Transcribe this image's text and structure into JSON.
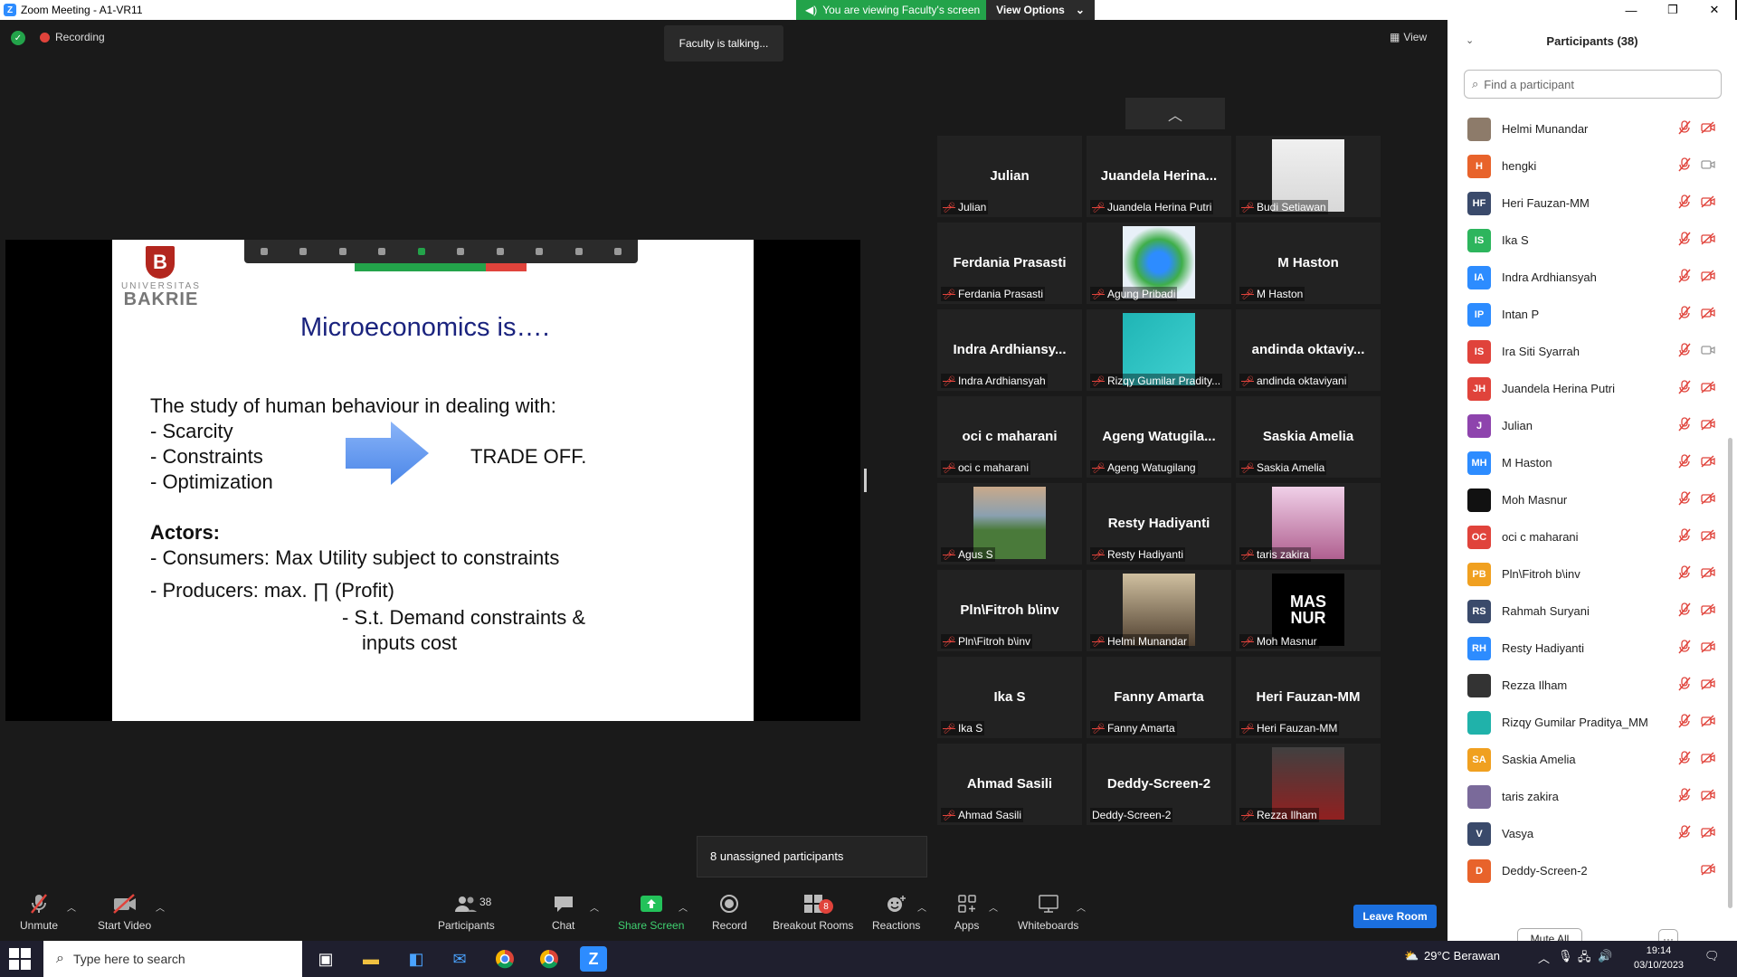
{
  "window": {
    "title": "Zoom Meeting - A1-VR11",
    "viewing_banner": "You are viewing Faculty's screen",
    "view_options": "View Options"
  },
  "topbar": {
    "recording": "Recording",
    "talking": "Faculty is talking...",
    "view": "View"
  },
  "slide": {
    "logo_top": "UNIVERSITAS",
    "logo_bottom": "BAKRIE",
    "title": "Microeconomics is….",
    "intro": "The study of human behaviour in dealing with:",
    "bullets": [
      "-   Scarcity",
      "-   Constraints",
      "-   Optimization"
    ],
    "tradeoff": "TRADE OFF.",
    "actors": "Actors:",
    "consumers": "- Consumers: Max Utility subject to constraints",
    "producers": "-   Producers: max. ∏ (Profit)",
    "demand1": "-  S.t. Demand constraints &",
    "demand2": "inputs cost"
  },
  "gallery": {
    "tiles": [
      {
        "center": "Julian",
        "label": "Julian"
      },
      {
        "center": "Juandela  Herina...",
        "label": "Juandela Herina Putri"
      },
      {
        "center": "",
        "label": "Budi Setiawan"
      },
      {
        "center": "Ferdania Prasasti",
        "label": "Ferdania Prasasti"
      },
      {
        "center": "",
        "label": "Agung Pribadi"
      },
      {
        "center": "M Haston",
        "label": "M Haston"
      },
      {
        "center": "Indra  Ardhiansy...",
        "label": "Indra Ardhiansyah"
      },
      {
        "center": "",
        "label": "Rizqy Gumilar Pradity..."
      },
      {
        "center": "andinda  oktaviy...",
        "label": "andinda oktaviyani"
      },
      {
        "center": "oci c maharani",
        "label": "oci c maharani"
      },
      {
        "center": "Ageng  Watugila...",
        "label": "Ageng Watugilang"
      },
      {
        "center": "Saskia Amelia",
        "label": "Saskia Amelia"
      },
      {
        "center": "",
        "label": "Agus S"
      },
      {
        "center": "Resty Hadiyanti",
        "label": "Resty Hadiyanti"
      },
      {
        "center": "",
        "label": "taris zakira"
      },
      {
        "center": "Pln\\Fitroh b\\inv",
        "label": "Pln\\Fitroh b\\inv"
      },
      {
        "center": "",
        "label": "Helmi Munandar"
      },
      {
        "center": "",
        "label": "Moh Masnur"
      },
      {
        "center": "Ika S",
        "label": "Ika S"
      },
      {
        "center": "Fanny Amarta",
        "label": "Fanny Amarta"
      },
      {
        "center": "Heri Fauzan-MM",
        "label": "Heri Fauzan-MM"
      },
      {
        "center": "Ahmad Sasili",
        "label": "Ahmad Sasili"
      },
      {
        "center": "Deddy-Screen-2",
        "label": "Deddy-Screen-2"
      },
      {
        "center": "",
        "label": "Rezza Ilham"
      }
    ],
    "masnur_logo": "MAS NUR"
  },
  "unassigned": "8 unassigned participants",
  "toolbar": {
    "unmute": "Unmute",
    "start_video": "Start Video",
    "participants": "Participants",
    "participants_count": "38",
    "chat": "Chat",
    "share_screen": "Share Screen",
    "record": "Record",
    "breakout": "Breakout Rooms",
    "breakout_count": "8",
    "reactions": "Reactions",
    "apps": "Apps",
    "whiteboards": "Whiteboards",
    "leave_room": "Leave Room"
  },
  "panel": {
    "title": "Participants (38)",
    "search_placeholder": "Find a participant",
    "mute_all": "Mute All",
    "more": "···",
    "participants": [
      {
        "initials": "",
        "name": "Helmi Munandar",
        "color": "#8d7b6a",
        "video": "off"
      },
      {
        "initials": "H",
        "name": "hengki",
        "color": "#e8632b",
        "video": "on"
      },
      {
        "initials": "HF",
        "name": "Heri Fauzan-MM",
        "color": "#3a4a6b",
        "video": "off"
      },
      {
        "initials": "IS",
        "name": "Ika S",
        "color": "#2db55d",
        "video": "off"
      },
      {
        "initials": "IA",
        "name": "Indra Ardhiansyah",
        "color": "#2d8cff",
        "video": "off"
      },
      {
        "initials": "IP",
        "name": "Intan P",
        "color": "#2d8cff",
        "video": "off"
      },
      {
        "initials": "IS",
        "name": "Ira Siti Syarrah",
        "color": "#e0433b",
        "video": "on"
      },
      {
        "initials": "JH",
        "name": "Juandela Herina Putri",
        "color": "#e0433b",
        "video": "off"
      },
      {
        "initials": "J",
        "name": "Julian",
        "color": "#8e44ad",
        "video": "off"
      },
      {
        "initials": "MH",
        "name": "M Haston",
        "color": "#2d8cff",
        "video": "off"
      },
      {
        "initials": "",
        "name": "Moh Masnur",
        "color": "#111111",
        "video": "off"
      },
      {
        "initials": "OC",
        "name": "oci c maharani",
        "color": "#e0433b",
        "video": "off"
      },
      {
        "initials": "PB",
        "name": "Pln\\Fitroh b\\inv",
        "color": "#f0a020",
        "video": "off"
      },
      {
        "initials": "RS",
        "name": "Rahmah Suryani",
        "color": "#3a4a6b",
        "video": "off"
      },
      {
        "initials": "RH",
        "name": "Resty Hadiyanti",
        "color": "#2d8cff",
        "video": "off"
      },
      {
        "initials": "",
        "name": "Rezza Ilham",
        "color": "#333333",
        "video": "off"
      },
      {
        "initials": "",
        "name": "Rizqy Gumilar Praditya_MM",
        "color": "#20b2aa",
        "video": "off"
      },
      {
        "initials": "SA",
        "name": "Saskia Amelia",
        "color": "#f0a020",
        "video": "off"
      },
      {
        "initials": "",
        "name": "taris zakira",
        "color": "#7a6a9a",
        "video": "off"
      },
      {
        "initials": "V",
        "name": "Vasya",
        "color": "#3a4a6b",
        "video": "off"
      },
      {
        "initials": "D",
        "name": "Deddy-Screen-2",
        "color": "#e8632b",
        "video": "off"
      }
    ]
  },
  "taskbar": {
    "search_placeholder": "Type here to search",
    "weather": "29°C  Berawan",
    "time": "19:14",
    "date": "03/10/2023"
  }
}
